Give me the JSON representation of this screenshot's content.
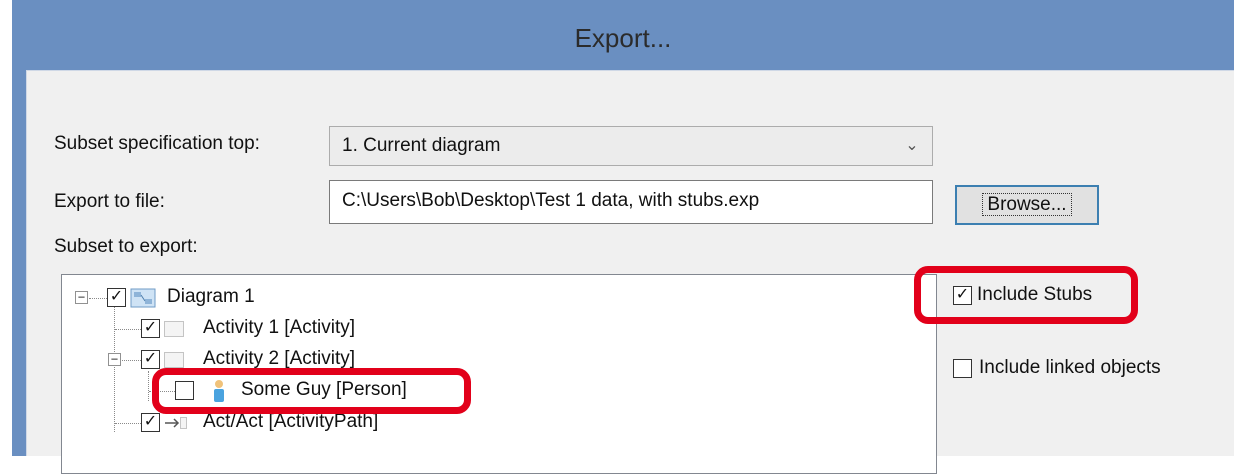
{
  "dialog": {
    "title": "Export...",
    "subset_spec_label": "Subset specification top:",
    "subset_spec_value": "1. Current diagram",
    "export_file_label": "Export to file:",
    "export_file_value": "C:\\Users\\Bob\\Desktop\\Test 1 data, with stubs.exp",
    "browse_label": "Browse...",
    "subset_export_label": "Subset to export:",
    "include_stubs_label": "Include Stubs",
    "include_stubs_checked": true,
    "include_linked_label": "Include linked objects",
    "include_linked_checked": false
  },
  "tree": {
    "nodes": [
      {
        "label": "Diagram 1",
        "checked": true,
        "icon": "diagram-icon",
        "expander": "minus"
      },
      {
        "label": "Activity 1 [Activity]",
        "checked": true,
        "icon": "activity-icon"
      },
      {
        "label": "Activity 2 [Activity]",
        "checked": true,
        "icon": "activity-icon",
        "expander": "minus"
      },
      {
        "label": "Some Guy [Person]",
        "checked": false,
        "icon": "person-icon"
      },
      {
        "label": "Act/Act [ActivityPath]",
        "checked": true,
        "icon": "activity-path-icon"
      }
    ]
  },
  "colors": {
    "titlebar": "#6a8fc1",
    "highlight": "#e2001a"
  }
}
